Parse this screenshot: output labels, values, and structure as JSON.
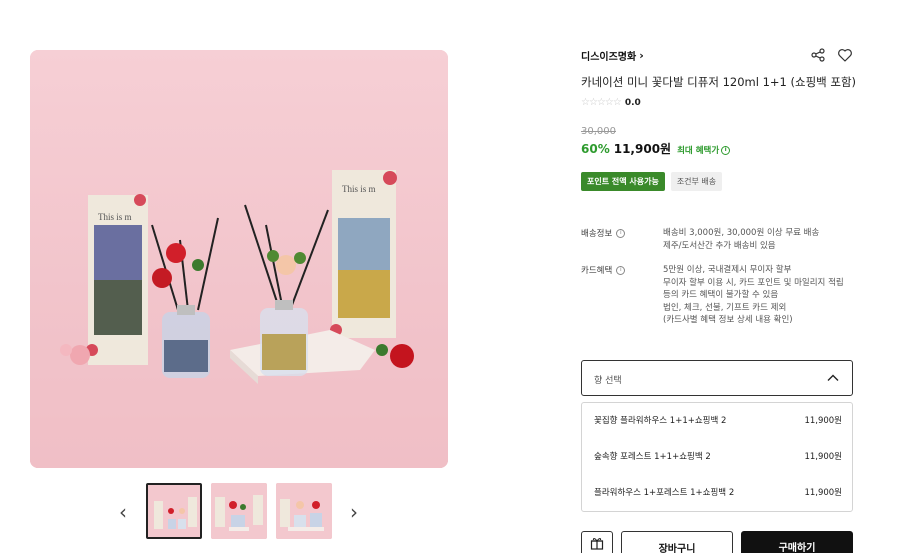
{
  "product": {
    "brand": "디스이즈명화",
    "title": "카네이션 미니 꽃다발 디퓨저 120ml 1+1 (쇼핑백 포함)",
    "rating_stars": "☆☆☆☆☆",
    "rating_value": "0.0",
    "original_price": "30,000",
    "discount": "60%",
    "price": "11,900원",
    "max_benefit": "최대 혜택가",
    "tags": [
      "포인트 전액 사용가능",
      "조건부 배송"
    ]
  },
  "shipping": {
    "label": "배송정보",
    "lines": [
      "배송비 3,000원, 30,000원 이상 무료 배송",
      "제주/도서산간 추가 배송비 있음"
    ]
  },
  "card": {
    "label": "카드혜택",
    "lines": [
      "5만원 이상, 국내결제시 무이자 할부",
      "무이자 할부 이용 시, 카드 포인트 및 마일리지 적립",
      "등의 카드 혜택이 불가할 수 있음",
      "법인, 체크, 선불, 기프트 카드 제외",
      "(카드사별 혜택 정보 상세 내용 확인)"
    ]
  },
  "option_select": {
    "placeholder": "향 선택"
  },
  "options": [
    {
      "name": "꽃집향 플라워하우스 1+1+쇼핑백 2",
      "price": "11,900원"
    },
    {
      "name": "숲속향 포레스트 1+1+쇼핑백 2",
      "price": "11,900원"
    },
    {
      "name": "플라워하우스 1+포레스트 1+쇼핑백 2",
      "price": "11,900원"
    }
  ],
  "buttons": {
    "cart": "장바구니",
    "buy": "구매하기"
  },
  "gallery": {
    "prev_icon": "chevron-left-icon",
    "next_icon": "chevron-right-icon",
    "box_left_label": "This is m",
    "box_right_label": "This is m"
  },
  "colors": {
    "accent_green": "#2e9b2e",
    "tag_green": "#3a8a2a",
    "buy_button": "#111111",
    "hero_pink": "#f4c9cf"
  }
}
